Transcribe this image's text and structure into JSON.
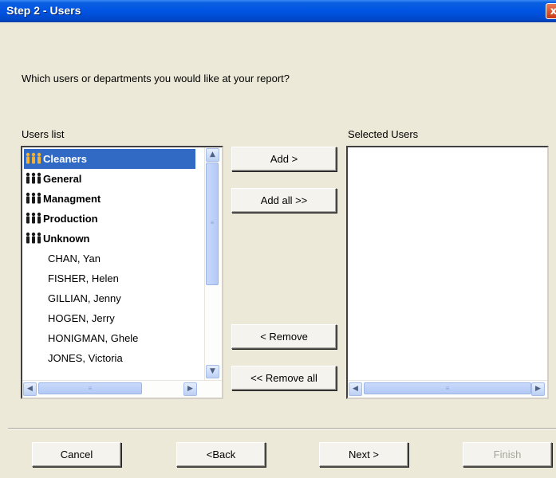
{
  "window": {
    "title": "Step 2 - Users",
    "close_glyph": "x"
  },
  "question": "Which users or departments you would like at your report?",
  "users_list": {
    "label": "Users list",
    "items": [
      {
        "text": "Cleaners",
        "type": "group",
        "selected": true
      },
      {
        "text": "General",
        "type": "group",
        "selected": false
      },
      {
        "text": "Managment",
        "type": "group",
        "selected": false
      },
      {
        "text": "Production",
        "type": "group",
        "selected": false
      },
      {
        "text": "Unknown",
        "type": "group",
        "selected": false
      },
      {
        "text": "CHAN, Yan",
        "type": "user",
        "selected": false
      },
      {
        "text": "FISHER, Helen",
        "type": "user",
        "selected": false
      },
      {
        "text": "GILLIAN, Jenny",
        "type": "user",
        "selected": false
      },
      {
        "text": "HOGEN, Jerry",
        "type": "user",
        "selected": false
      },
      {
        "text": "HONIGMAN, Ghele",
        "type": "user",
        "selected": false
      },
      {
        "text": "JONES, Victoria",
        "type": "user",
        "selected": false
      }
    ]
  },
  "selected_users": {
    "label": "Selected Users",
    "items": []
  },
  "transfer_buttons": {
    "add": "Add >",
    "add_all": "Add all >>",
    "remove": "< Remove",
    "remove_all": "<< Remove all"
  },
  "footer_buttons": {
    "cancel": "Cancel",
    "back": "<Back",
    "next": "Next >",
    "finish": "Finish",
    "finish_enabled": false
  },
  "icons": {
    "group_icon": "group-people-icon",
    "scroll_up": "▲",
    "scroll_down": "▼",
    "scroll_left": "◀",
    "scroll_right": "▶",
    "grip": "≡"
  },
  "colors": {
    "titlebar": "#0054e3",
    "selection": "#316ac5",
    "dialog_bg": "#ece9d8"
  }
}
